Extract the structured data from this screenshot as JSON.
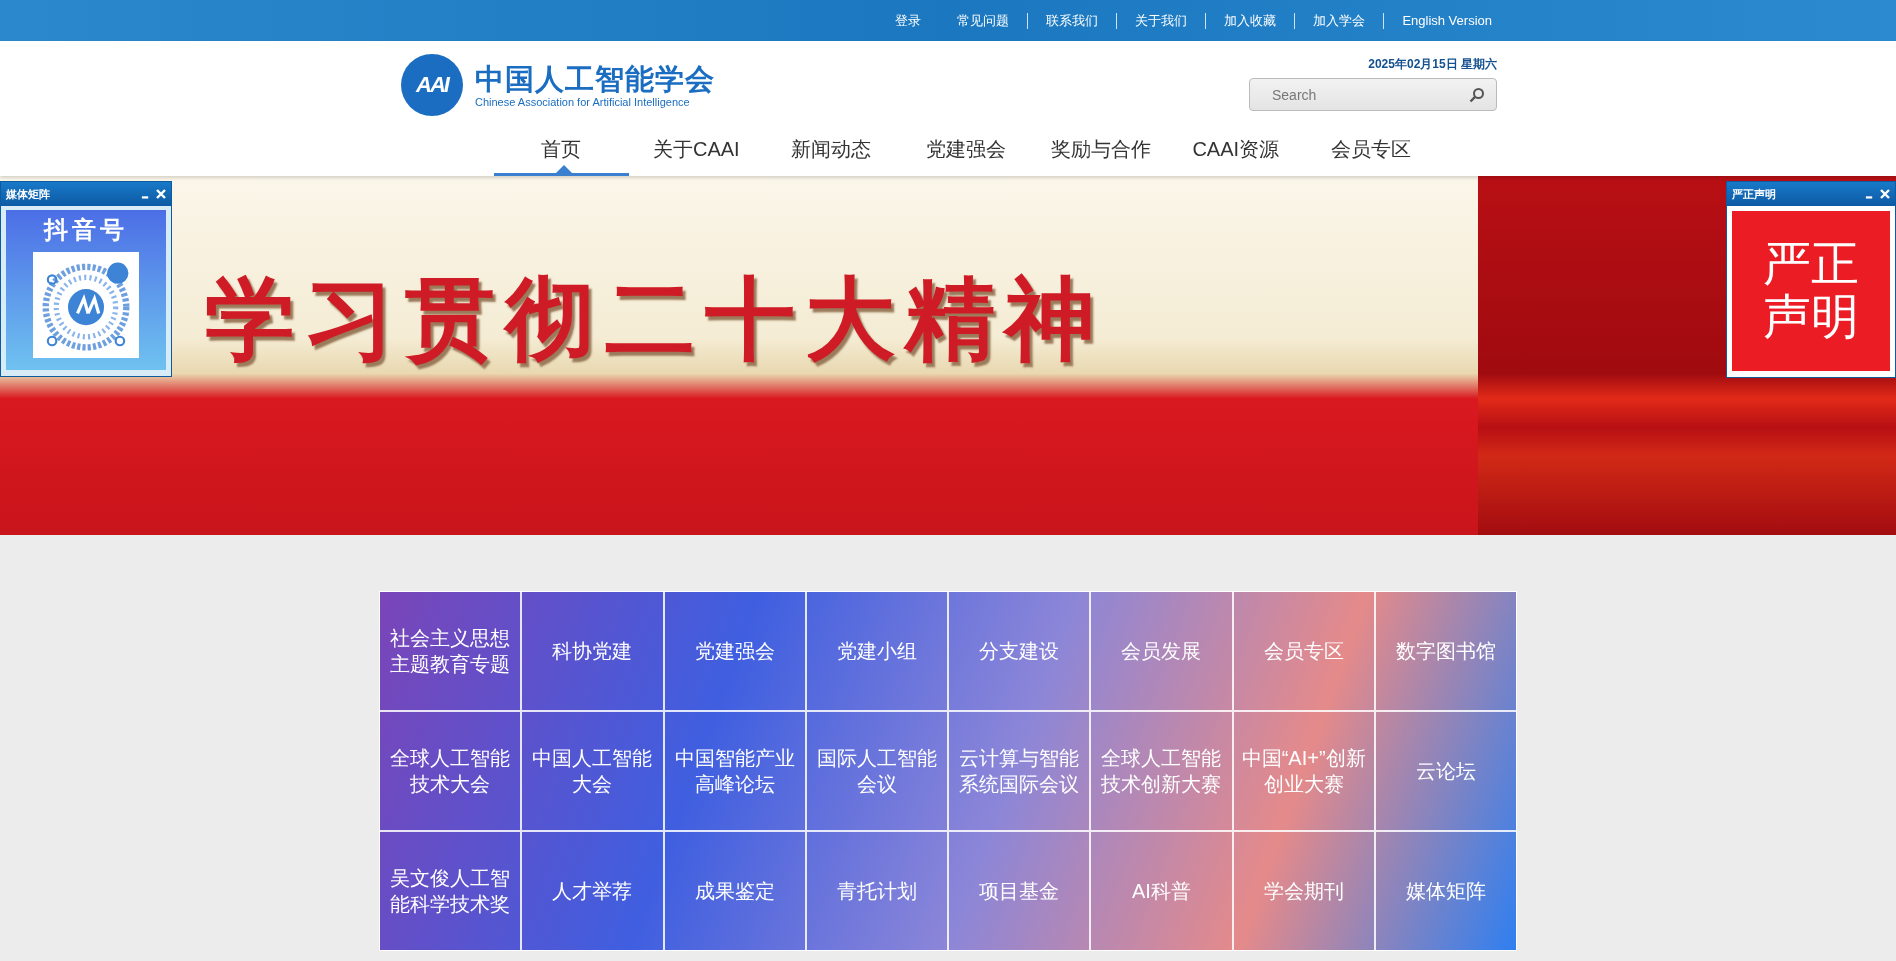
{
  "top_links": [
    "登录",
    "常见问题",
    "联系我们",
    "关于我们",
    "加入收藏",
    "加入学会",
    "English Version"
  ],
  "logo": {
    "mark": "AAI",
    "title": "中国人工智能学会",
    "subtitle": "Chinese Association for Artificial Intelligence"
  },
  "date": "2025年02月15日 星期六",
  "search": {
    "placeholder": "Search"
  },
  "nav": [
    {
      "label": "首页",
      "selected": true
    },
    {
      "label": "关于CAAI",
      "selected": false
    },
    {
      "label": "新闻动态",
      "selected": false
    },
    {
      "label": "党建强会",
      "selected": false
    },
    {
      "label": "奖励与合作",
      "selected": false
    },
    {
      "label": "CAAI资源",
      "selected": false
    },
    {
      "label": "会员专区",
      "selected": false
    }
  ],
  "banner": {
    "title": "学习贯彻二十大精神"
  },
  "float_left": {
    "title": "媒体矩阵",
    "heading": "抖音号"
  },
  "float_right": {
    "title": "严正声明",
    "text": "严正声明"
  },
  "grid": [
    [
      "社会主义思想主题教育专题",
      "科协党建",
      "党建强会",
      "党建小组",
      "分支建设",
      "会员发展",
      "会员专区",
      "数字图书馆"
    ],
    [
      "全球人工智能技术大会",
      "中国人工智能大会",
      "中国智能产业高峰论坛",
      "国际人工智能会议",
      "云计算与智能系统国际会议",
      "全球人工智能技术创新大赛",
      "中国“AI+”创新创业大赛",
      "云论坛"
    ],
    [
      "吴文俊人工智能科学技术奖",
      "人才举荐",
      "成果鉴定",
      "青托计划",
      "项目基金",
      "AI科普",
      "学会期刊",
      "媒体矩阵"
    ]
  ]
}
